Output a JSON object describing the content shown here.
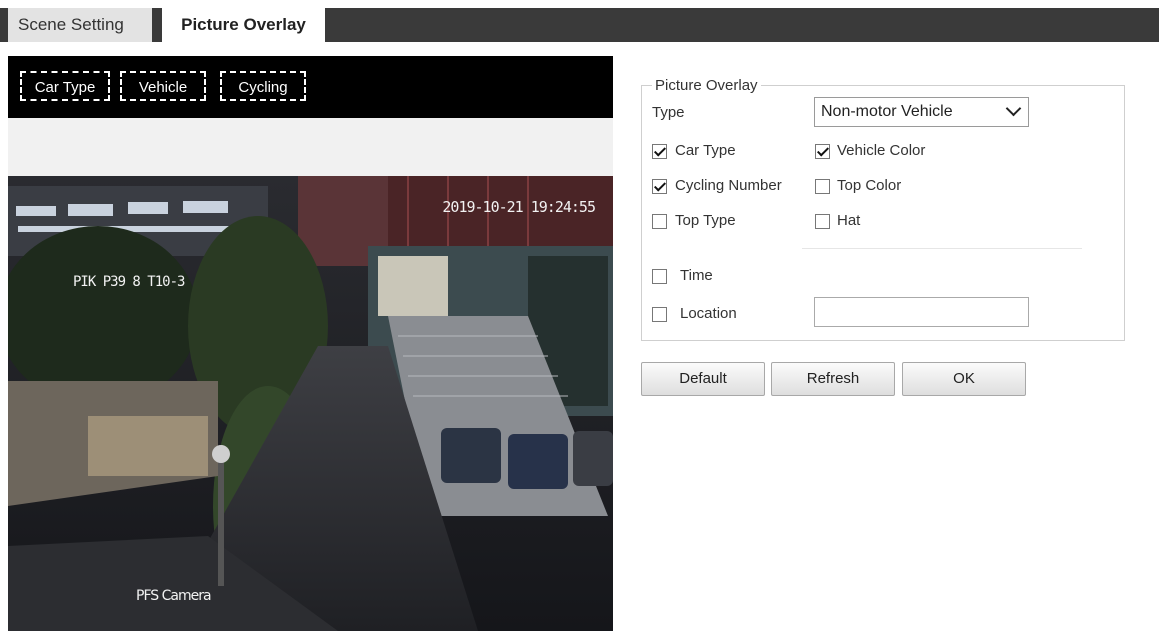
{
  "tabs": [
    {
      "label": "Scene Setting",
      "active": false
    },
    {
      "label": "Picture Overlay",
      "active": true
    }
  ],
  "preview": {
    "overlay_tags": [
      "Car Type",
      "Vehicle",
      "Cycling"
    ],
    "camera_timestamp": "2019-10-21 19:24:55",
    "camera_overlay_text": "PIK P39 8 T10-3",
    "camera_name": "PFS Camera"
  },
  "settings": {
    "group_title": "Picture Overlay",
    "type_label": "Type",
    "type_value": "Non-motor Vehicle",
    "checkboxes": [
      {
        "label": "Car Type",
        "checked": true
      },
      {
        "label": "Vehicle Color",
        "checked": true
      },
      {
        "label": "Cycling Number",
        "checked": true
      },
      {
        "label": "Top Color",
        "checked": false
      },
      {
        "label": "Top Type",
        "checked": false
      },
      {
        "label": "Hat",
        "checked": false
      }
    ],
    "time": {
      "label": "Time",
      "checked": false
    },
    "location": {
      "label": "Location",
      "checked": false,
      "value": ""
    }
  },
  "buttons": {
    "default": "Default",
    "refresh": "Refresh",
    "ok": "OK"
  },
  "colors": {
    "tabbar": "#3a3a3a",
    "preview_background": "#000000"
  }
}
